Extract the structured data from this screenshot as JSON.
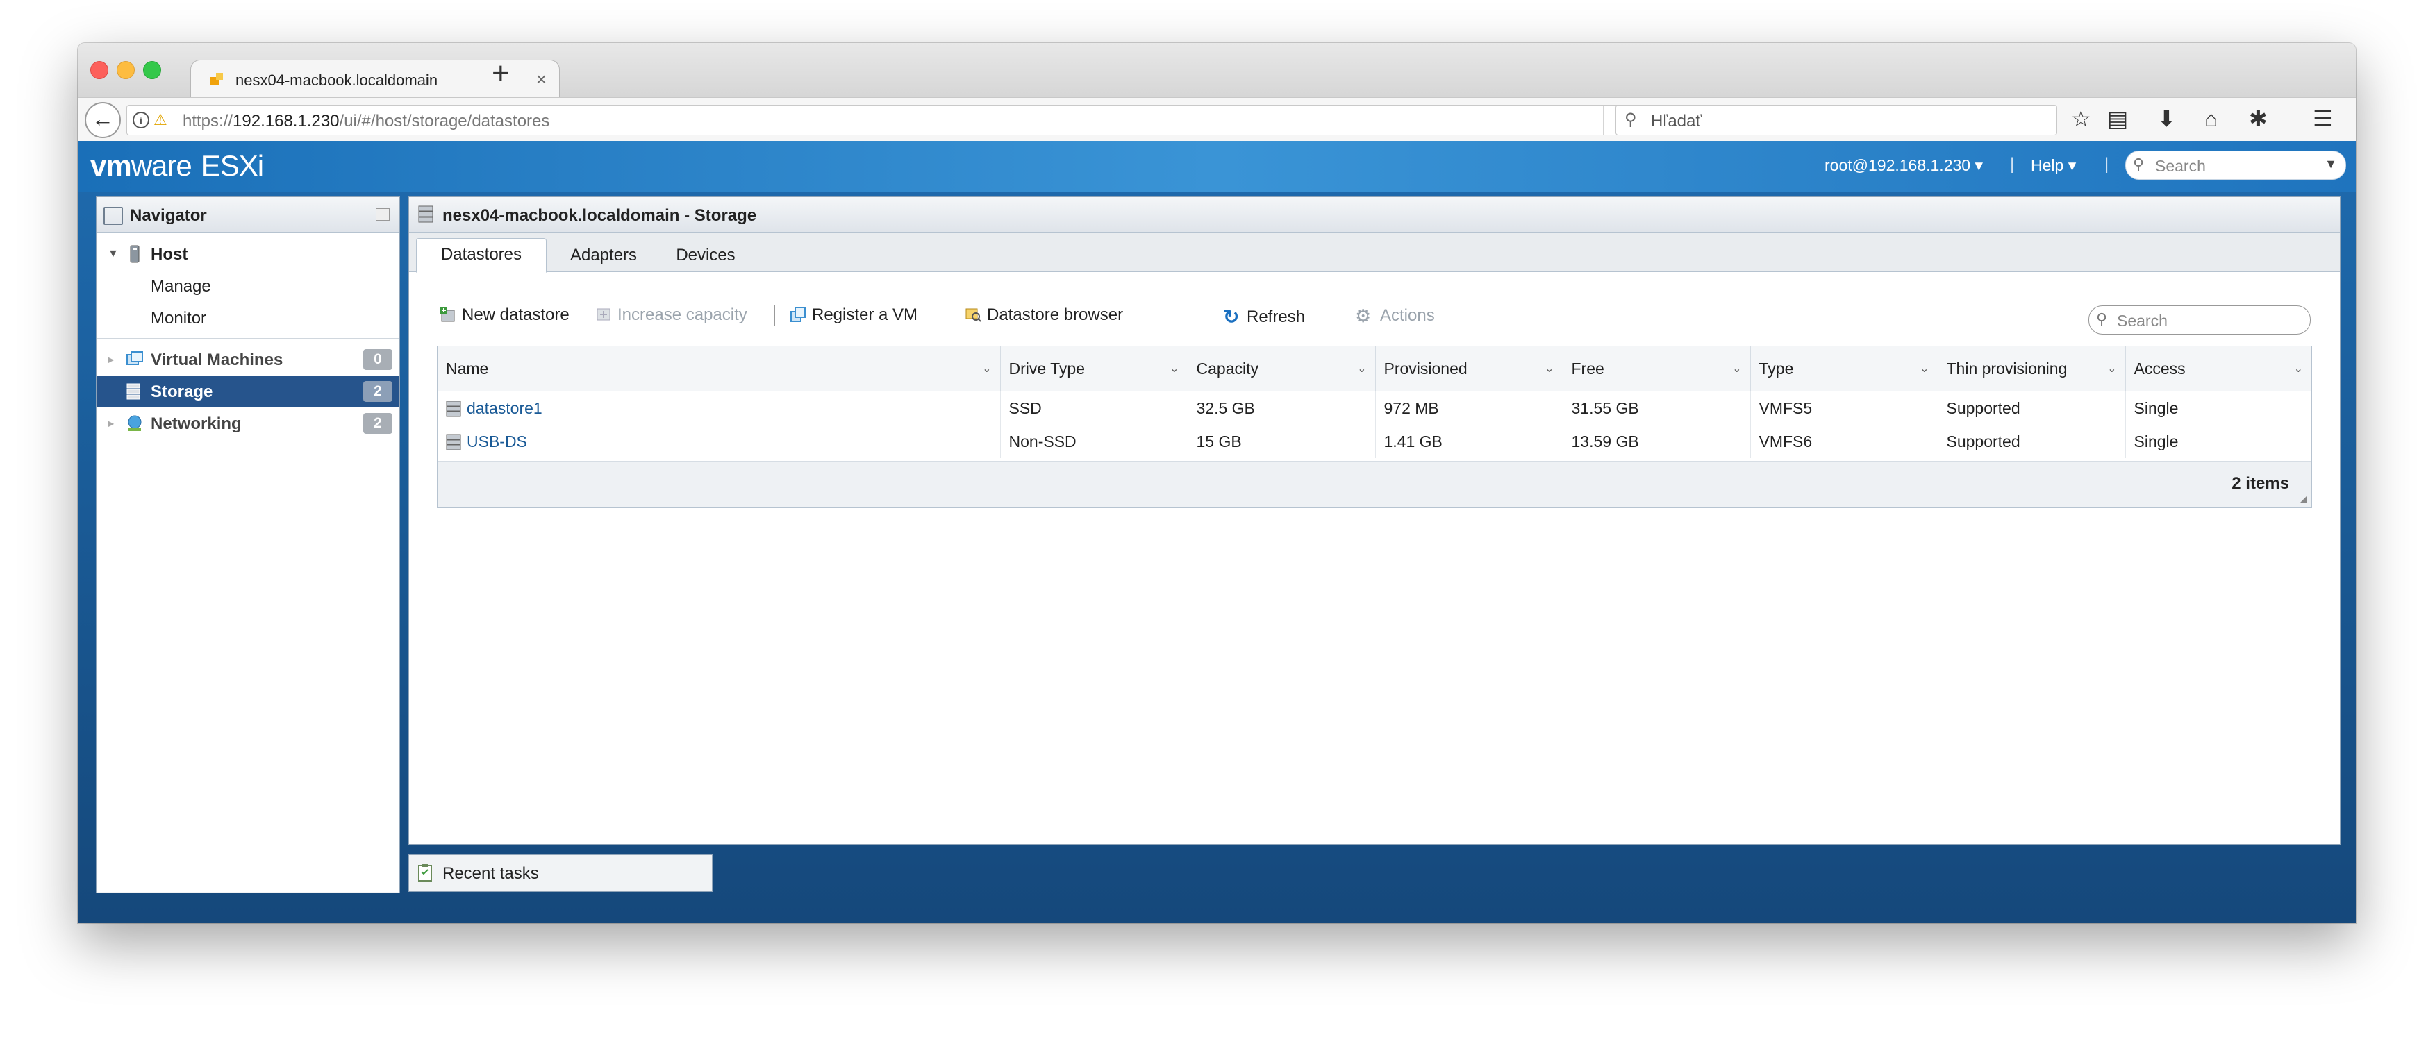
{
  "browser": {
    "tab_title": "nesx04-macbook.localdomain",
    "tab_close": "×",
    "new_tab": "+",
    "url_prefix": "https://",
    "url_host": "192.168.1.230",
    "url_path": "/ui/#/host/storage/datastores",
    "search_placeholder": "Hľadať"
  },
  "header": {
    "logo_vm": "vm",
    "logo_ware": "ware",
    "logo_product": "ESXi",
    "user": "root@192.168.1.230 ▾",
    "separator": "|",
    "help": "Help ▾",
    "search_placeholder": "Search"
  },
  "navigator": {
    "title": "Navigator",
    "host_label": "Host",
    "host_children": [
      "Manage",
      "Monitor"
    ],
    "items": [
      {
        "label": "Virtual Machines",
        "count": "0"
      },
      {
        "label": "Storage",
        "count": "2"
      },
      {
        "label": "Networking",
        "count": "2"
      }
    ]
  },
  "main": {
    "title": "nesx04-macbook.localdomain - Storage",
    "tabs": [
      "Datastores",
      "Adapters",
      "Devices"
    ],
    "toolbar": {
      "new_datastore": "New datastore",
      "increase_capacity": "Increase capacity",
      "register_vm": "Register a VM",
      "datastore_browser": "Datastore browser",
      "refresh": "Refresh",
      "actions": "Actions"
    },
    "search_placeholder": "Search",
    "columns": [
      "Name",
      "Drive Type",
      "Capacity",
      "Provisioned",
      "Free",
      "Type",
      "Thin provisioning",
      "Access"
    ],
    "rows": [
      [
        "datastore1",
        "SSD",
        "32.5 GB",
        "972 MB",
        "31.55 GB",
        "VMFS5",
        "Supported",
        "Single"
      ],
      [
        "USB-DS",
        "Non-SSD",
        "15 GB",
        "1.41 GB",
        "13.59 GB",
        "VMFS6",
        "Supported",
        "Single"
      ]
    ],
    "item_count": "2 items"
  },
  "recent_tasks": "Recent tasks",
  "colors": {
    "header_blue": "#1f74be",
    "selected_nav": "#26548c",
    "link": "#1a5a96"
  }
}
